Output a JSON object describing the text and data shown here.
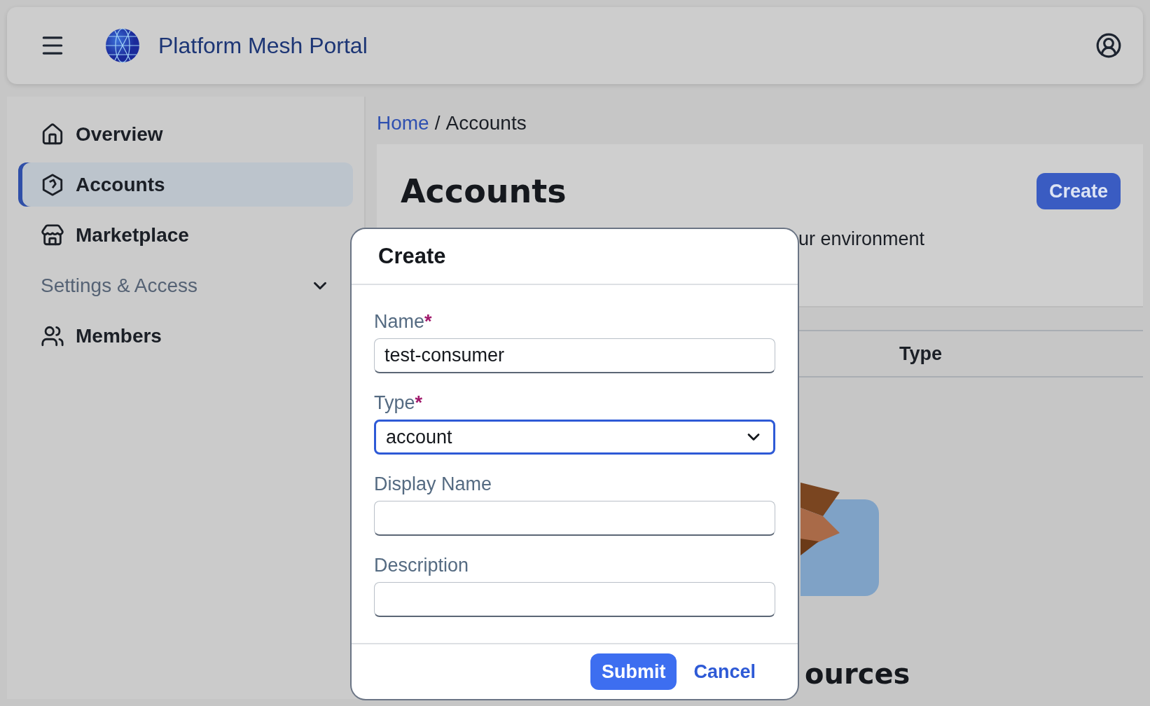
{
  "header": {
    "title": "Platform Mesh Portal"
  },
  "sidebar": {
    "items": [
      {
        "kind": "link",
        "label": "Overview",
        "selected": false
      },
      {
        "kind": "link",
        "label": "Accounts",
        "selected": true
      },
      {
        "kind": "link",
        "label": "Marketplace",
        "selected": false
      },
      {
        "kind": "group",
        "label": "Settings & Access",
        "selected": false,
        "expanded": false
      },
      {
        "kind": "link",
        "label": "Members",
        "selected": false
      }
    ]
  },
  "breadcrumb": {
    "separator": "/",
    "items": [
      {
        "kind": "link",
        "label": "Home"
      },
      {
        "kind": "current",
        "label": "Accounts"
      }
    ]
  },
  "page": {
    "title": "Accounts",
    "create_button": "Create",
    "description": "ur environment",
    "table": {
      "columns": [
        "Type"
      ]
    },
    "empty_state": {
      "kind": "picture",
      "title": "ources"
    }
  },
  "dialog": {
    "title": "Create",
    "required_mark": "*",
    "fields": [
      {
        "kind": "text",
        "label": "Name",
        "required": true,
        "value": "test-consumer",
        "focused": false
      },
      {
        "kind": "select",
        "label": "Type",
        "required": true,
        "value": "account",
        "focused": true
      },
      {
        "kind": "text",
        "label": "Display Name",
        "required": false,
        "focused": false
      },
      {
        "kind": "text",
        "label": "Description",
        "required": false,
        "focused": false
      }
    ],
    "buttons": [
      {
        "kind": "primary",
        "label": "Submit"
      },
      {
        "kind": "link",
        "label": "Cancel"
      }
    ]
  }
}
